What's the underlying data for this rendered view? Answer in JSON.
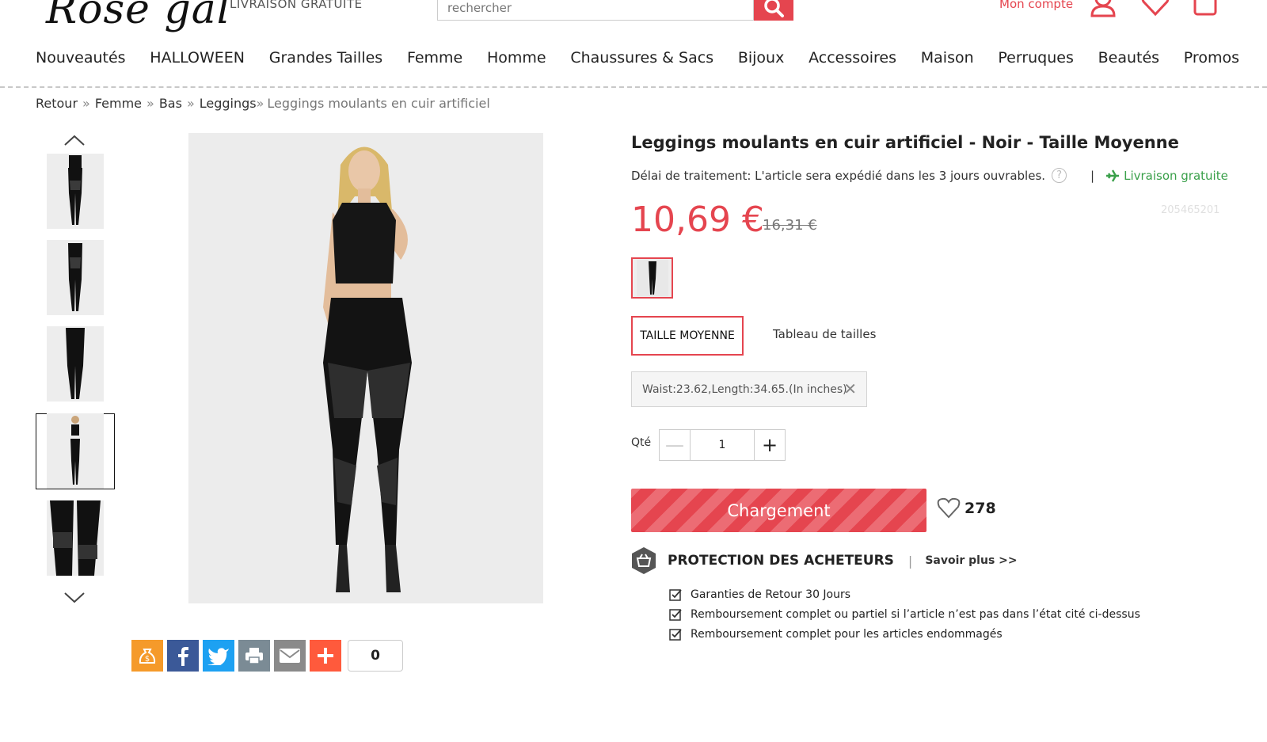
{
  "header": {
    "logo": "Rose gal",
    "free_shipping": "LIVRAISON GRATUITE",
    "search_placeholder": "rechercher",
    "account": "Mon compte"
  },
  "nav": [
    "Nouveautés",
    "HALLOWEEN",
    "Grandes Tailles",
    "Femme",
    "Homme",
    "Chaussures & Sacs",
    "Bijoux",
    "Accessoires",
    "Maison",
    "Perruques",
    "Beautés",
    "Promos"
  ],
  "breadcrumb": {
    "items": [
      "Retour",
      "Femme",
      "Bas",
      "Leggings"
    ],
    "sep": "»",
    "current": "Leggings moulants en cuir artificiel"
  },
  "product": {
    "title": "Leggings moulants en cuir artificiel - Noir - Taille Moyenne",
    "processing": "Délai de traitement: L'article sera expédié dans les 3 jours ouvrables.",
    "help_icon": "?",
    "pipe": "|",
    "free_shipping": "Livraison gratuite",
    "sku": "205465201",
    "price": "10,69 €",
    "old_price": "16,31 €",
    "size": "TAILLE MOYENNE",
    "size_chart": "Tableau de tailles",
    "size_info": "Waist:23.62,Length:34.65.(In inches)",
    "size_info_close": "✕",
    "qty_label": "Qté",
    "qty_value": "1",
    "qty_minus": "—",
    "qty_plus": "+",
    "add_button": "Chargement",
    "wishlist_count": "278"
  },
  "protection": {
    "title": "PROTECTION DES ACHETEURS",
    "sep": "|",
    "learn_more": "Savoir plus >>",
    "items": [
      "Garanties de Retour 30 Jours",
      "Remboursement complet ou partiel si l’article n’est pas dans l’état cité ci-dessus",
      "Remboursement complet pour les articles endommagés"
    ]
  },
  "share": {
    "count": "0"
  },
  "colors": {
    "accent": "#e5454f",
    "green": "#3aa04a"
  }
}
